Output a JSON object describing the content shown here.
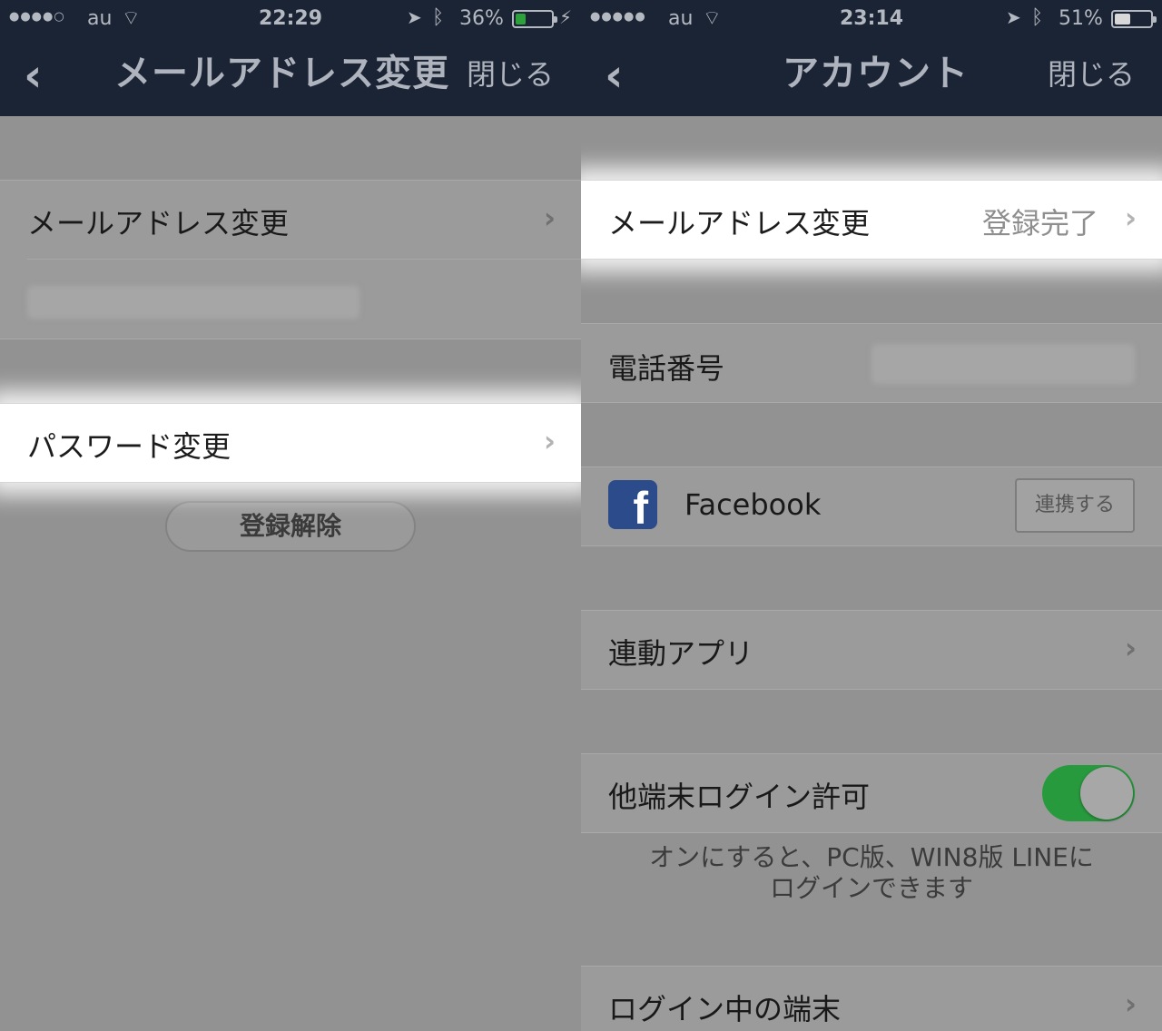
{
  "left": {
    "status": {
      "signal": "●●●●○",
      "carrier": "au",
      "time": "22:29",
      "battery_pct": "36%",
      "battery_level": 0.36,
      "battery_color": "#2ea23a"
    },
    "nav": {
      "back": "‹",
      "title": "メールアドレス変更",
      "close": "閉じる"
    },
    "email_row": {
      "label": "メールアドレス変更"
    },
    "password_row": {
      "label": "パスワード変更"
    },
    "unregister_button": "登録解除"
  },
  "right": {
    "status": {
      "signal": "●●●●●",
      "carrier": "au",
      "time": "23:14",
      "battery_pct": "51%",
      "battery_level": 0.51,
      "battery_color": "#d8d8d8"
    },
    "nav": {
      "back": "‹",
      "title": "アカウント",
      "close": "閉じる"
    },
    "email_row": {
      "label": "メールアドレス変更",
      "value": "登録完了"
    },
    "phone_row": {
      "label": "電話番号"
    },
    "facebook_row": {
      "icon": "f",
      "label": "Facebook",
      "button": "連携する"
    },
    "apps_row": {
      "label": "連動アプリ"
    },
    "login_row": {
      "label": "他端末ログイン許可",
      "enabled": true,
      "toggle_color": "#289a3e"
    },
    "login_note_line1": "オンにすると、PC版、WIN8版 LINEに",
    "login_note_line2": "ログインできます",
    "devices_row": {
      "label": "ログイン中の端末"
    }
  }
}
